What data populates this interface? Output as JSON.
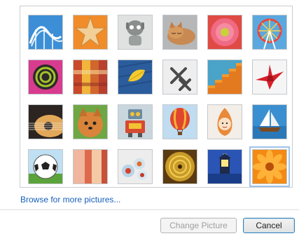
{
  "pictures": [
    {
      "name": "roller-coaster"
    },
    {
      "name": "starfish"
    },
    {
      "name": "robot"
    },
    {
      "name": "kitten"
    },
    {
      "name": "pink-flower"
    },
    {
      "name": "ferris-wheel"
    },
    {
      "name": "ball"
    },
    {
      "name": "fabric"
    },
    {
      "name": "leaf"
    },
    {
      "name": "jacks"
    },
    {
      "name": "stairs"
    },
    {
      "name": "paper-crane"
    },
    {
      "name": "guitar"
    },
    {
      "name": "puppy"
    },
    {
      "name": "tin-robot"
    },
    {
      "name": "hot-air-balloon"
    },
    {
      "name": "doll"
    },
    {
      "name": "sailboat"
    },
    {
      "name": "soccer-ball"
    },
    {
      "name": "cloth"
    },
    {
      "name": "marbles"
    },
    {
      "name": "fan"
    },
    {
      "name": "lighthouse"
    },
    {
      "name": "orange-flower"
    }
  ],
  "selected_picture": "orange-flower",
  "links": {
    "browse": "Browse for more pictures..."
  },
  "buttons": {
    "change_picture": "Change Picture",
    "cancel": "Cancel"
  },
  "colors": {
    "link": "#1560bd",
    "selection": "#9fc3ea"
  }
}
